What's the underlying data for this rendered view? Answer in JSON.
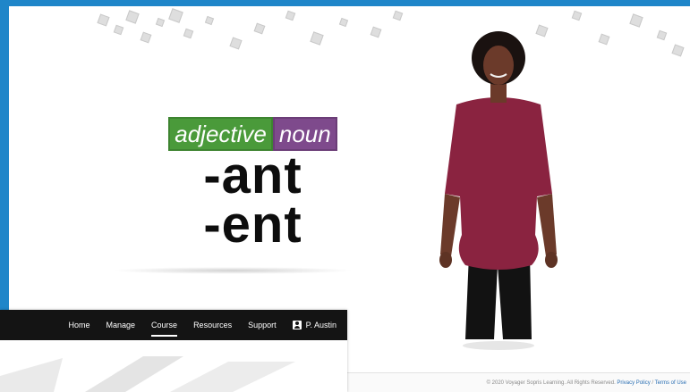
{
  "lesson": {
    "label_adjective": "adjective",
    "label_noun": "noun",
    "suffixes": [
      "-ant",
      "-ent"
    ]
  },
  "nav": {
    "items": [
      "Home",
      "Manage",
      "Course",
      "Resources",
      "Support"
    ],
    "active": "Course",
    "user": "P. Austin"
  },
  "footer": {
    "copyright": "© 2020 Voyager Sopris Learning. All Rights Reserved.",
    "privacy": "Privacy Policy",
    "terms": "Terms of Use"
  },
  "colors": {
    "frame": "#1f86c9",
    "adjective_tag": "#4a9a3a",
    "noun_tag": "#7e4a8c",
    "navbar": "#141414",
    "presenter_top": "#8a2340"
  }
}
